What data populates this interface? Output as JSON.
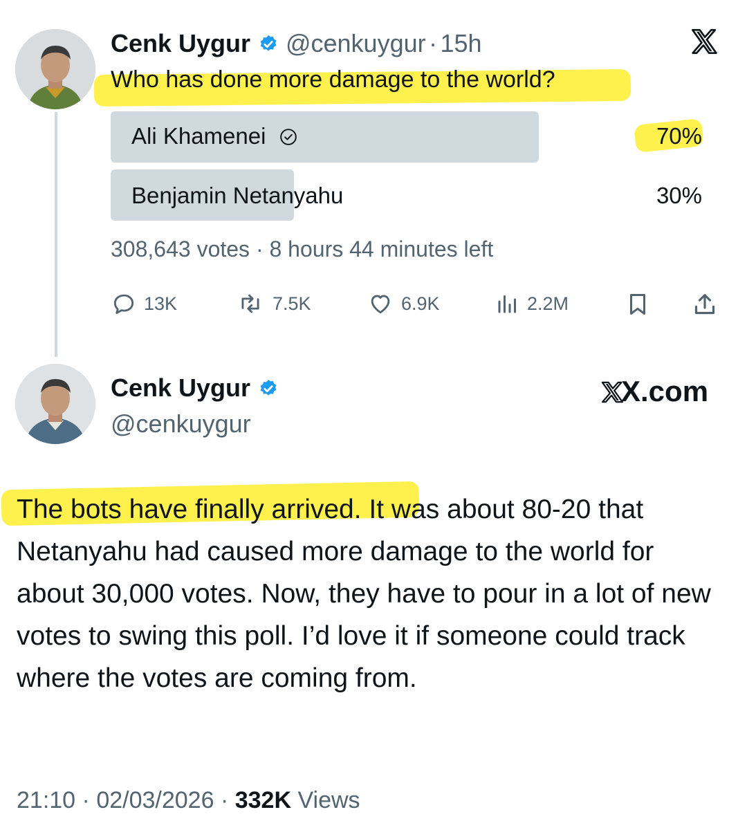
{
  "quoted_post": {
    "author_name": "Cenk Uygur",
    "handle": "@cenkuygur",
    "separator": "·",
    "time_ago": "15h",
    "question": "Who has done more damage to the world?",
    "poll": {
      "options": [
        {
          "label": "Ali Khamenei",
          "percent_text": "70%",
          "share": 0.7,
          "selected": true
        },
        {
          "label": "Benjamin Netanyahu",
          "percent_text": "30%",
          "share": 0.3,
          "selected": false
        }
      ],
      "votes": "308,643 votes",
      "separator": "·",
      "time_left": "8 hours 44 minutes left"
    },
    "actions": {
      "replies": "13K",
      "reposts": "7.5K",
      "likes": "6.9K",
      "views": "2.2M"
    }
  },
  "main_post": {
    "author_name": "Cenk Uygur",
    "handle": "@cenkuygur",
    "site_label": "X.com",
    "text_highlighted": "The bots have finally arrived.",
    "text_rest": " It was about 80-20 that Netanyahu had caused more damage to the world for about 30,000 votes. Now, they have to pour in a lot of new votes to swing this poll. I’d love it if someone could track where the votes are coming from.",
    "time": "21:10",
    "separator1": "·",
    "date": "02/03/2026",
    "separator2": "·",
    "views_count": "332K",
    "views_label": "Views"
  },
  "colors": {
    "highlight": "#ffef2e",
    "verified": "#1d9bf0",
    "poll_bar": "#cfd9de",
    "muted_text": "#536471"
  },
  "icons": [
    "verified-badge-icon",
    "x-logo-icon",
    "checkmark-circle-icon",
    "reply-icon",
    "repost-icon",
    "like-icon",
    "views-icon",
    "bookmark-icon",
    "share-icon"
  ]
}
